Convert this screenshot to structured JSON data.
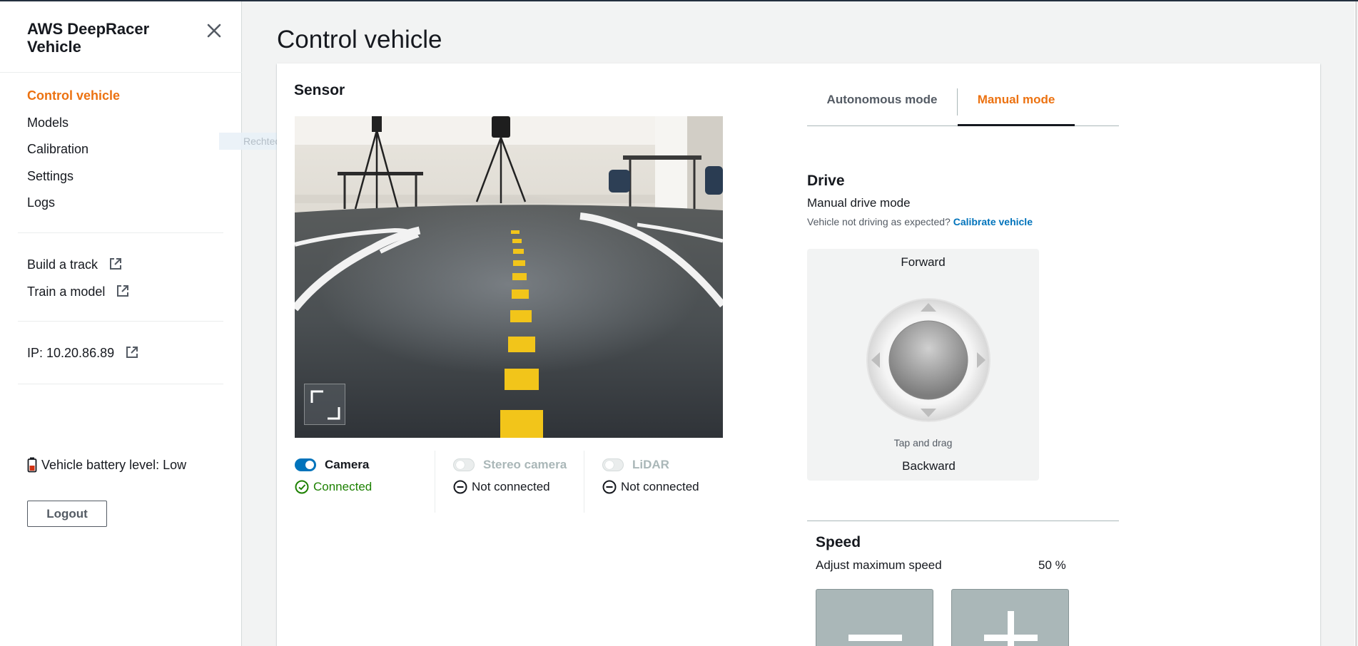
{
  "sidebar": {
    "title": "AWS DeepRacer Vehicle",
    "nav": [
      {
        "label": "Control vehicle",
        "active": true
      },
      {
        "label": "Models"
      },
      {
        "label": "Calibration"
      },
      {
        "label": "Settings"
      },
      {
        "label": "Logs"
      }
    ],
    "links": [
      {
        "label": "Build a track",
        "icon": "external-link-icon"
      },
      {
        "label": "Train a model",
        "icon": "external-link-icon"
      }
    ],
    "ip": "IP: 10.20.86.89",
    "battery": {
      "label": "Vehicle battery level: Low",
      "icon": "battery-low-icon"
    },
    "logout_label": "Logout",
    "tooltip_ghost": "Rechteckiges Ausschneiden"
  },
  "page": {
    "title": "Control vehicle"
  },
  "sensor": {
    "title": "Sensor",
    "sensors": [
      {
        "name": "Camera",
        "enabled": true,
        "status": "Connected"
      },
      {
        "name": "Stereo camera",
        "enabled": false,
        "status": "Not connected"
      },
      {
        "name": "LiDAR",
        "enabled": false,
        "status": "Not connected"
      }
    ]
  },
  "modes": {
    "tabs": [
      {
        "label": "Autonomous mode",
        "active": false
      },
      {
        "label": "Manual mode",
        "active": true
      }
    ]
  },
  "drive": {
    "title": "Drive",
    "subtitle": "Manual drive mode",
    "help_text": "Vehicle not driving as expected?",
    "help_link": "Calibrate vehicle",
    "forward": "Forward",
    "backward": "Backward",
    "hint": "Tap and drag"
  },
  "speed": {
    "title": "Speed",
    "subtitle": "Adjust maximum speed",
    "value": "50 %"
  },
  "colors": {
    "accent": "#ec7211",
    "link": "#0073bb",
    "success": "#1d8102",
    "battery_low": "#d13212"
  }
}
